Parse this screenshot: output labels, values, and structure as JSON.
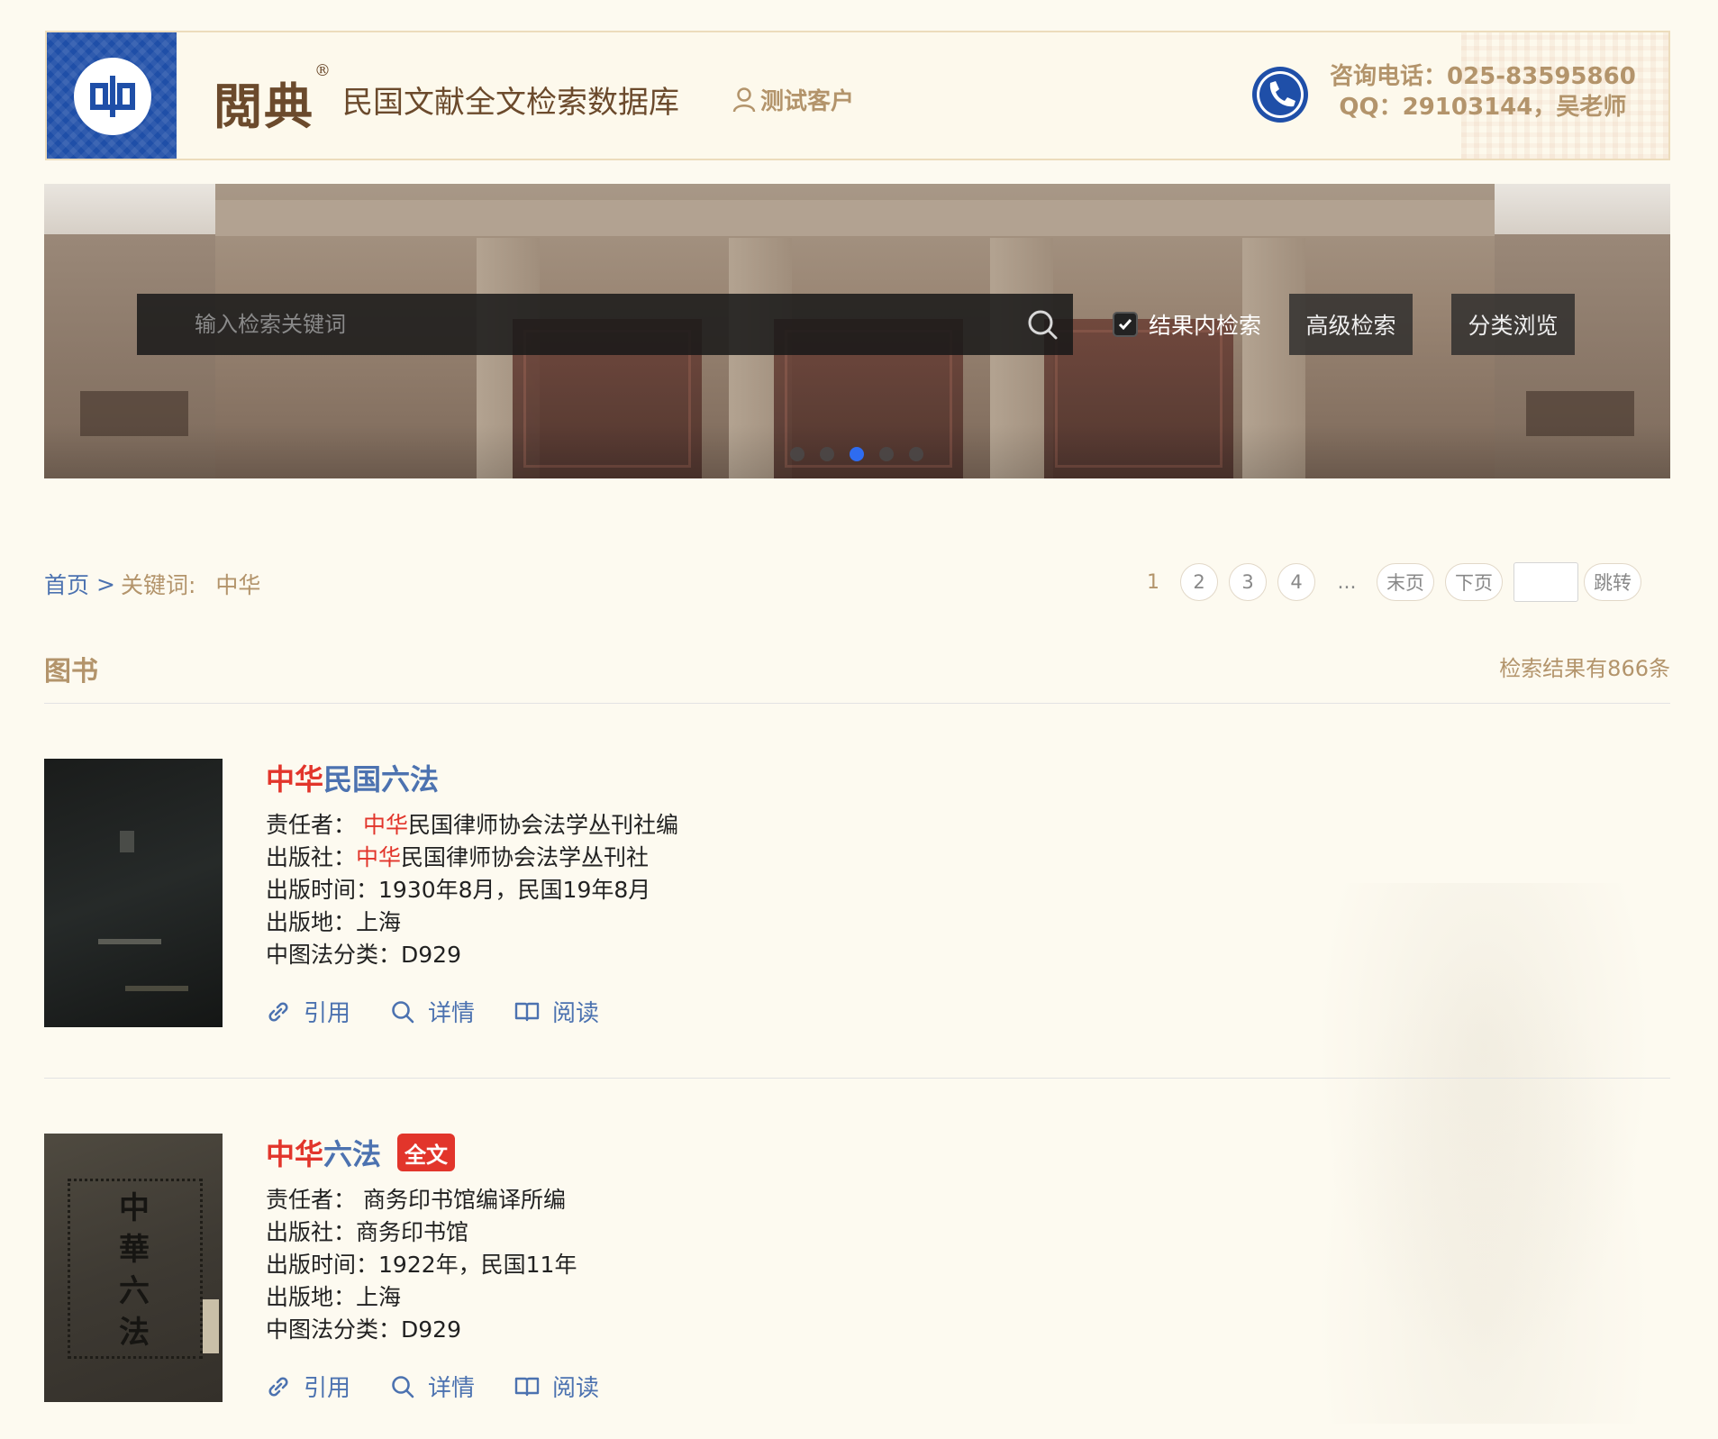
{
  "header": {
    "brand": "閲典",
    "registered": "®",
    "db_title": "民国文献全文检索数据库",
    "user": "测试客户",
    "contact_phone": "咨询电话：025-83595860",
    "contact_qq": "QQ：29103144，吴老师",
    "logo_color": "#1f4fa8"
  },
  "search": {
    "placeholder": "输入检索关键词",
    "value": "",
    "inside_label": "结果内检索",
    "inside_checked": true,
    "advanced_label": "高级检索",
    "browse_label": "分类浏览"
  },
  "carousel": {
    "count": 5,
    "active_index": 2
  },
  "breadcrumb": {
    "home": "首页",
    "separator": ">",
    "keyword_label": "关键词:",
    "keyword": "中华"
  },
  "pager": {
    "current": "1",
    "pages": [
      "2",
      "3",
      "4"
    ],
    "ellipsis": "...",
    "last": "末页",
    "next": "下页",
    "jump_value": "",
    "jump": "跳转"
  },
  "section": {
    "title": "图书",
    "count_text": "检索结果有866条"
  },
  "records": [
    {
      "title_hl": "中华",
      "title_rest": "民国六法",
      "full_text_tag": "",
      "author_label": "责任者：",
      "author_hl": "中华",
      "author_rest": "民国律师协会法学丛刊社编",
      "publisher_label": "出版社：",
      "publisher_hl": "中华",
      "publisher_rest": "民国律师协会法学丛刊社",
      "date_label": "出版时间：",
      "date": "1930年8月，民国19年8月",
      "place_label": "出版地：",
      "place": "上海",
      "class_label": "中图法分类：",
      "class": "D929"
    },
    {
      "title_hl": "中华",
      "title_rest": "六法",
      "full_text_tag": "全文",
      "author_label": "责任者：",
      "author_hl": "",
      "author_rest": "商务印书馆编译所编",
      "publisher_label": "出版社：",
      "publisher_hl": "",
      "publisher_rest": "商务印书馆",
      "date_label": "出版时间：",
      "date": "1922年，民国11年",
      "place_label": "出版地：",
      "place": "上海",
      "class_label": "中图法分类：",
      "class": "D929",
      "cover_text": "中華六法"
    }
  ],
  "actions": {
    "cite": "引用",
    "detail": "详情",
    "read": "阅读"
  },
  "colors": {
    "accent_gold": "#b3946b",
    "link_blue": "#4c72b0",
    "highlight_red": "#e2352b",
    "active_dot": "#2e6cf0"
  }
}
